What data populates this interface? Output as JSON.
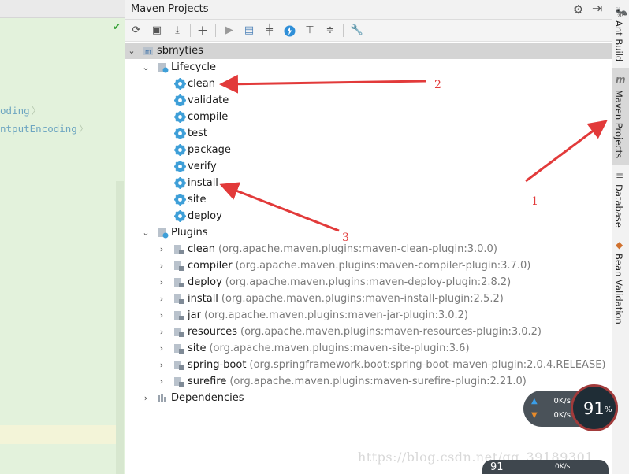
{
  "editor": {
    "code_lines": [
      "oding",
      "ntputEncoding"
    ],
    "check_mark": "✔"
  },
  "panel": {
    "title": "Maven Projects",
    "toolbar_icons": [
      "refresh-icon",
      "generate-sources-icon",
      "download-icon",
      "add-icon",
      "run-icon",
      "execute-goal-icon",
      "toggle-offline-icon",
      "skip-tests-icon",
      "show-dependencies-icon",
      "collapse-all-icon",
      "settings-wrench-icon"
    ]
  },
  "tree": {
    "project": "sbmyties",
    "lifecycle_label": "Lifecycle",
    "lifecycle": [
      "clean",
      "validate",
      "compile",
      "test",
      "package",
      "verify",
      "install",
      "site",
      "deploy"
    ],
    "plugins_label": "Plugins",
    "plugins": [
      {
        "name": "clean",
        "artifact": "(org.apache.maven.plugins:maven-clean-plugin:3.0.0)"
      },
      {
        "name": "compiler",
        "artifact": "(org.apache.maven.plugins:maven-compiler-plugin:3.7.0)"
      },
      {
        "name": "deploy",
        "artifact": "(org.apache.maven.plugins:maven-deploy-plugin:2.8.2)"
      },
      {
        "name": "install",
        "artifact": "(org.apache.maven.plugins:maven-install-plugin:2.5.2)"
      },
      {
        "name": "jar",
        "artifact": "(org.apache.maven.plugins:maven-jar-plugin:3.0.2)"
      },
      {
        "name": "resources",
        "artifact": "(org.apache.maven.plugins:maven-resources-plugin:3.0.2)"
      },
      {
        "name": "site",
        "artifact": "(org.apache.maven.plugins:maven-site-plugin:3.6)"
      },
      {
        "name": "spring-boot",
        "artifact": "(org.springframework.boot:spring-boot-maven-plugin:2.0.4.RELEASE)"
      },
      {
        "name": "surefire",
        "artifact": "(org.apache.maven.plugins:maven-surefire-plugin:2.21.0)"
      }
    ],
    "dependencies_label": "Dependencies"
  },
  "side_strip": {
    "tabs": [
      "Ant Build",
      "Maven Projects",
      "Database",
      "Bean Validation"
    ],
    "active": "Maven Projects"
  },
  "annotations": [
    "2",
    "1",
    "3"
  ],
  "widget": {
    "upload_speed": "0K/s",
    "download_speed": "0K/s",
    "percent": "91",
    "percent_sign": "%",
    "secondary_number": "91",
    "secondary_speed": "0K/s"
  },
  "watermark": "https://blog.csdn.net/qq_39189301",
  "colors": {
    "annotation": "#e23a3a",
    "gear_icon": "#3e9fd8",
    "editor_bg": "#e3f2dc"
  }
}
